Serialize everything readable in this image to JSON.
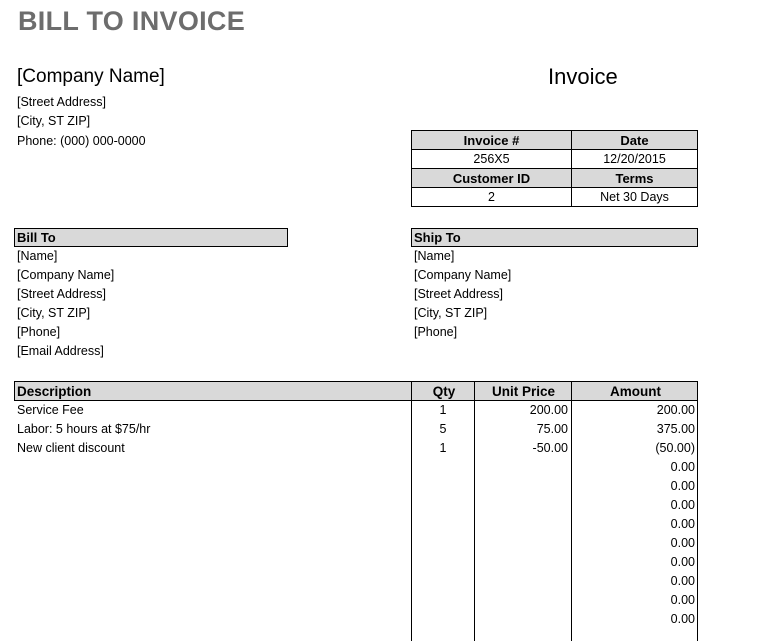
{
  "page_title": "BILL TO INVOICE",
  "company": {
    "name": "[Company Name]",
    "street": "[Street Address]",
    "city": "[City, ST ZIP]",
    "phone": "Phone: (000) 000-0000"
  },
  "invoice_heading": "Invoice",
  "info": {
    "invoice_no_label": "Invoice #",
    "date_label": "Date",
    "invoice_no": "256X5",
    "date": "12/20/2015",
    "customer_id_label": "Customer ID",
    "terms_label": "Terms",
    "customer_id": "2",
    "terms": "Net 30 Days"
  },
  "bill_to": {
    "label": "Bill To",
    "lines": [
      "[Name]",
      "[Company Name]",
      "[Street Address]",
      "[City, ST ZIP]",
      "[Phone]",
      "[Email Address]"
    ]
  },
  "ship_to": {
    "label": "Ship To",
    "lines": [
      "[Name]",
      "[Company Name]",
      "[Street Address]",
      "[City, ST ZIP]",
      "[Phone]"
    ]
  },
  "items": {
    "headers": {
      "description": "Description",
      "qty": "Qty",
      "unit_price": "Unit Price",
      "amount": "Amount"
    },
    "rows": [
      {
        "description": "Service Fee",
        "qty": "1",
        "unit_price": "200.00",
        "amount": "200.00"
      },
      {
        "description": "Labor: 5 hours at $75/hr",
        "qty": "5",
        "unit_price": "75.00",
        "amount": "375.00"
      },
      {
        "description": "New client discount",
        "qty": "1",
        "unit_price": "-50.00",
        "amount": "(50.00)"
      },
      {
        "description": "",
        "qty": "",
        "unit_price": "",
        "amount": "0.00"
      },
      {
        "description": "",
        "qty": "",
        "unit_price": "",
        "amount": "0.00"
      },
      {
        "description": "",
        "qty": "",
        "unit_price": "",
        "amount": "0.00"
      },
      {
        "description": "",
        "qty": "",
        "unit_price": "",
        "amount": "0.00"
      },
      {
        "description": "",
        "qty": "",
        "unit_price": "",
        "amount": "0.00"
      },
      {
        "description": "",
        "qty": "",
        "unit_price": "",
        "amount": "0.00"
      },
      {
        "description": "",
        "qty": "",
        "unit_price": "",
        "amount": "0.00"
      },
      {
        "description": "",
        "qty": "",
        "unit_price": "",
        "amount": "0.00"
      },
      {
        "description": "",
        "qty": "",
        "unit_price": "",
        "amount": "0.00"
      }
    ]
  }
}
